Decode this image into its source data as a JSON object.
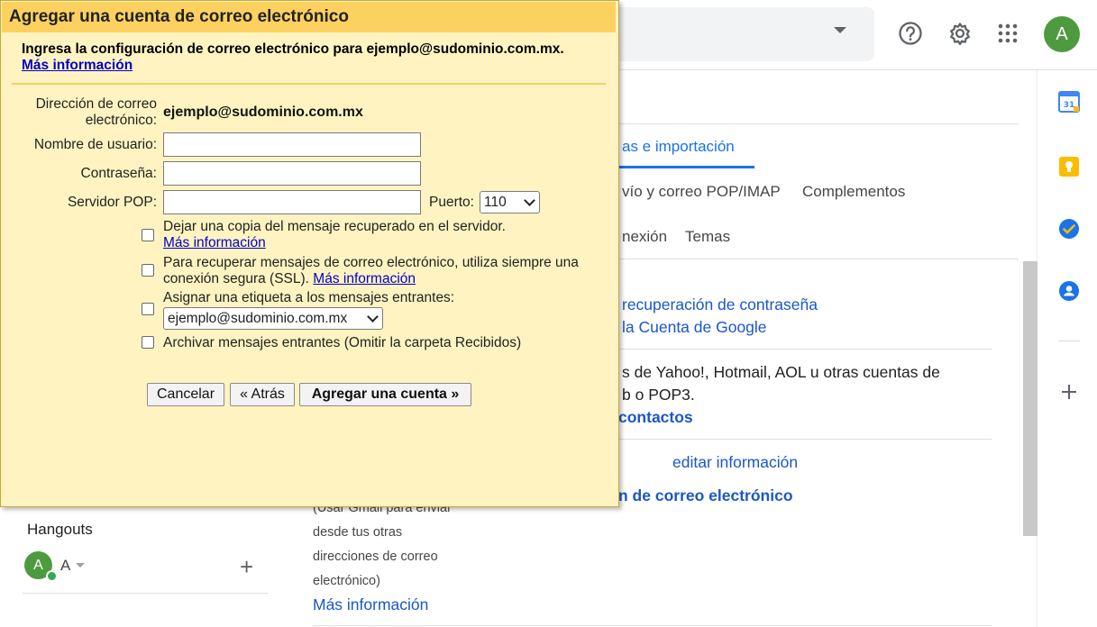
{
  "dialog": {
    "title": "Agregar una cuenta de correo electrónico",
    "subtitle": "Ingresa la configuración de correo electrónico para ejemplo@sudominio.com.mx.",
    "more_info": "Más información",
    "email_label_line1": "Dirección de correo",
    "email_label_line2": "electrónico:",
    "email_value": "ejemplo@sudominio.com.mx",
    "username_label": "Nombre de usuario:",
    "username_value": "",
    "password_label": "Contraseña:",
    "password_value": "",
    "pop_server_label": "Servidor POP:",
    "pop_server_value": "",
    "port_label": "Puerto:",
    "port_value": "110",
    "options": {
      "leave_copy": "Dejar una copia del mensaje recuperado en el servidor.",
      "leave_copy_link": "Más información",
      "ssl_line1": "Para recuperar mensajes de correo electrónico, utiliza siempre una",
      "ssl_line2": "conexión segura (SSL).",
      "ssl_link": "Más información",
      "label_incoming": "Asignar una etiqueta a los mensajes entrantes:",
      "label_select_value": "ejemplo@sudominio.com.mx",
      "archive": "Archivar mensajes entrantes (Omitir la carpeta Recibidos)"
    },
    "buttons": {
      "cancel": "Cancelar",
      "back": "« Atrás",
      "add": "Agregar una cuenta »"
    }
  },
  "background": {
    "tabs": {
      "accounts": "as e importación",
      "forwarding": "vío y correo POP/IMAP",
      "addons": "Complementos",
      "offline": "nexión",
      "themes": "Temas"
    },
    "links": {
      "recovery": "recuperación de contraseña",
      "google_account": "la Cuenta de Google",
      "import_text_line1": "s de Yahoo!, Hotmail, AOL u otras cuentas de",
      "import_text_line2": "b o POP3.",
      "contacts": "contactos",
      "edit_info": "editar información",
      "add_email": "n de correo electrónico"
    },
    "send_as_desc": {
      "line1": "(Usar Gmail para enviar",
      "line2": "desde tus otras",
      "line3": "direcciones de correo",
      "line4": "electrónico)",
      "more_info": "Más información"
    },
    "hangouts": {
      "title": "Hangouts",
      "avatar_letter": "A",
      "user_name": "A"
    },
    "top": {
      "avatar_letter": "A"
    }
  },
  "colors": {
    "dialog_bg": "#fff4c1",
    "dialog_title_bg": "#fcd15f",
    "link_blue": "#0000cc",
    "gmail_blue": "#1a73e8",
    "avatar_green": "#4e9a3f"
  },
  "icons": [
    "help-icon",
    "gear-icon",
    "apps-grid-icon",
    "calendar-icon",
    "keep-icon",
    "tasks-icon",
    "contacts-icon",
    "plus-icon",
    "dropdown-caret-icon"
  ]
}
